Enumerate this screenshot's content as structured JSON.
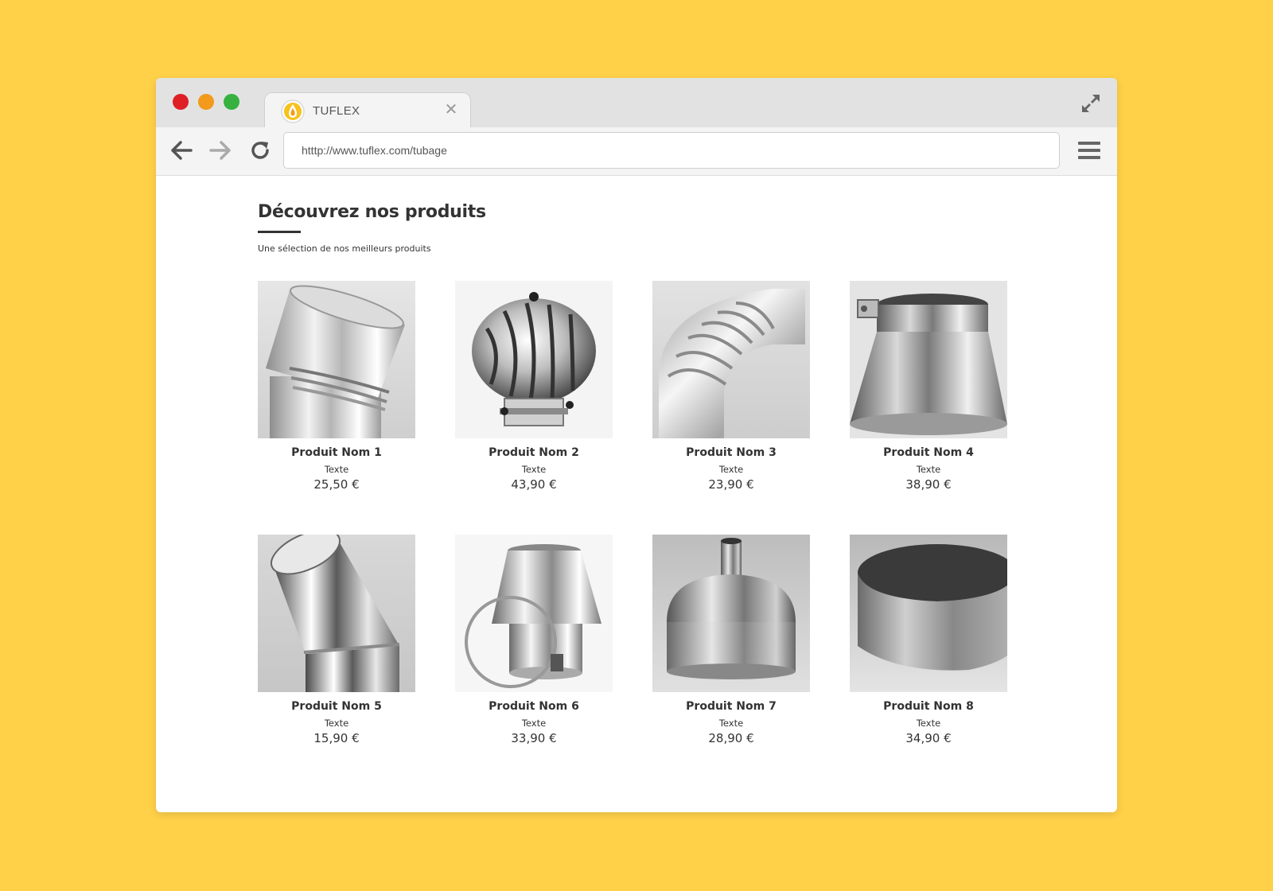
{
  "browser": {
    "tab_title": "TUFLEX",
    "url": "htttp://www.tuflex.com/tubage",
    "icons": {
      "close": "close-icon",
      "expand": "expand-icon",
      "back": "arrow-left-icon",
      "forward": "arrow-right-icon",
      "reload": "reload-icon",
      "menu": "hamburger-menu-icon"
    },
    "colors": {
      "background": "#ffd149",
      "close_dot": "#de1f26",
      "minimize_dot": "#f29a1b",
      "maximize_dot": "#36b13f"
    }
  },
  "page": {
    "title": "Découvrez nos produits",
    "subtitle": "Une sélection de nos meilleurs produits"
  },
  "products": [
    {
      "name": "Produit Nom 1",
      "text": "Texte",
      "price": "25,50 €",
      "image": "angled-pipe-elbow"
    },
    {
      "name": "Produit Nom 2",
      "text": "Texte",
      "price": "43,90 €",
      "image": "rotating-chimney-cowl"
    },
    {
      "name": "Produit Nom 3",
      "text": "Texte",
      "price": "23,90 €",
      "image": "segmented-elbow-pipe"
    },
    {
      "name": "Produit Nom 4",
      "text": "Texte",
      "price": "38,90 €",
      "image": "conical-rain-collar"
    },
    {
      "name": "Produit Nom 5",
      "text": "Texte",
      "price": "15,90 €",
      "image": "polished-pipe-bend"
    },
    {
      "name": "Produit Nom 6",
      "text": "Texte",
      "price": "33,90 €",
      "image": "cone-adapter-with-clamp"
    },
    {
      "name": "Produit Nom 7",
      "text": "Texte",
      "price": "28,90 €",
      "image": "dome-cap-with-outlet"
    },
    {
      "name": "Produit Nom 8",
      "text": "Texte",
      "price": "34,90 €",
      "image": "flat-end-cap"
    }
  ]
}
